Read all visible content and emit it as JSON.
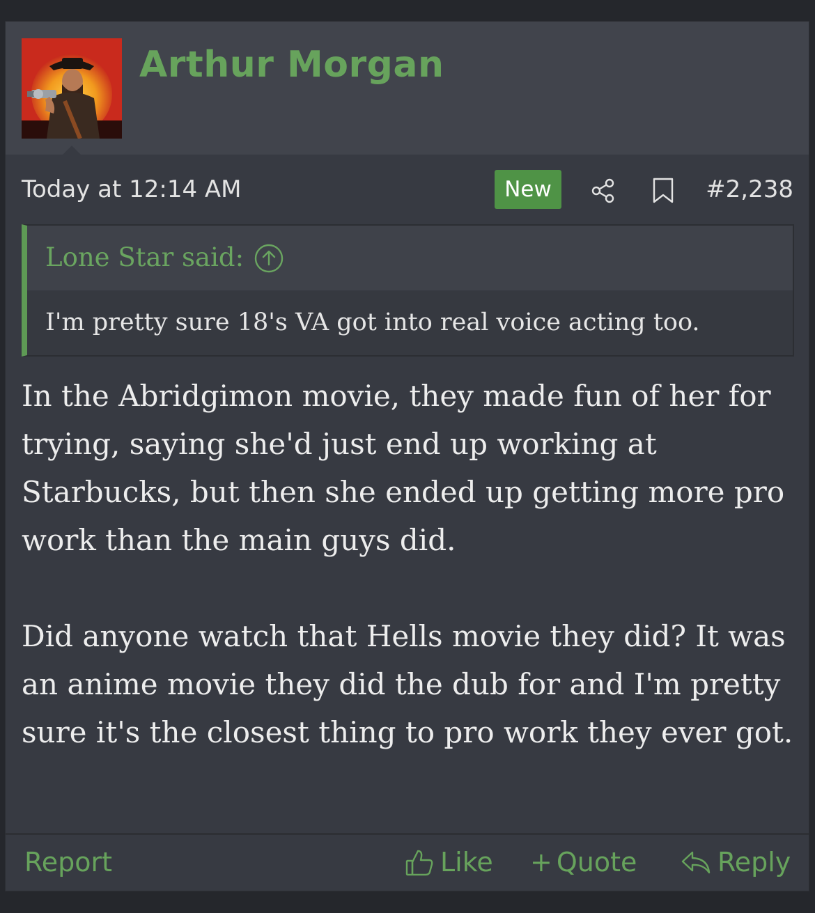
{
  "post": {
    "username": "Arthur Morgan",
    "timestamp": "Today at 12:14 AM",
    "new_badge": "New",
    "post_number": "#2,238",
    "quote": {
      "author": "Lone Star said:",
      "text": "I'm pretty sure 18's VA got into real voice acting too."
    },
    "body": {
      "paragraph_1": "In the Abridgimon movie, they made fun of her for trying, saying she'd just end up working at Starbucks, but then she ended up getting more pro work than the main guys did.",
      "paragraph_2": "Did anyone watch that Hells movie they did? It was an anime movie they did the dub for and I'm pretty sure it's the closest thing to pro work they ever got."
    }
  },
  "footer": {
    "report": "Report",
    "like": "Like",
    "quote_plus": "+",
    "quote": "Quote",
    "reply": "Reply"
  },
  "icons": {
    "share": "share-icon",
    "bookmark": "bookmark-icon",
    "quote_jump": "arrow-up-circle-icon",
    "like": "thumbs-up-icon",
    "reply": "reply-arrow-icon"
  },
  "colors": {
    "accent_green": "#67a35c",
    "badge_green": "#4f9346",
    "card_bg": "#373a42",
    "header_bg": "#41444c"
  }
}
